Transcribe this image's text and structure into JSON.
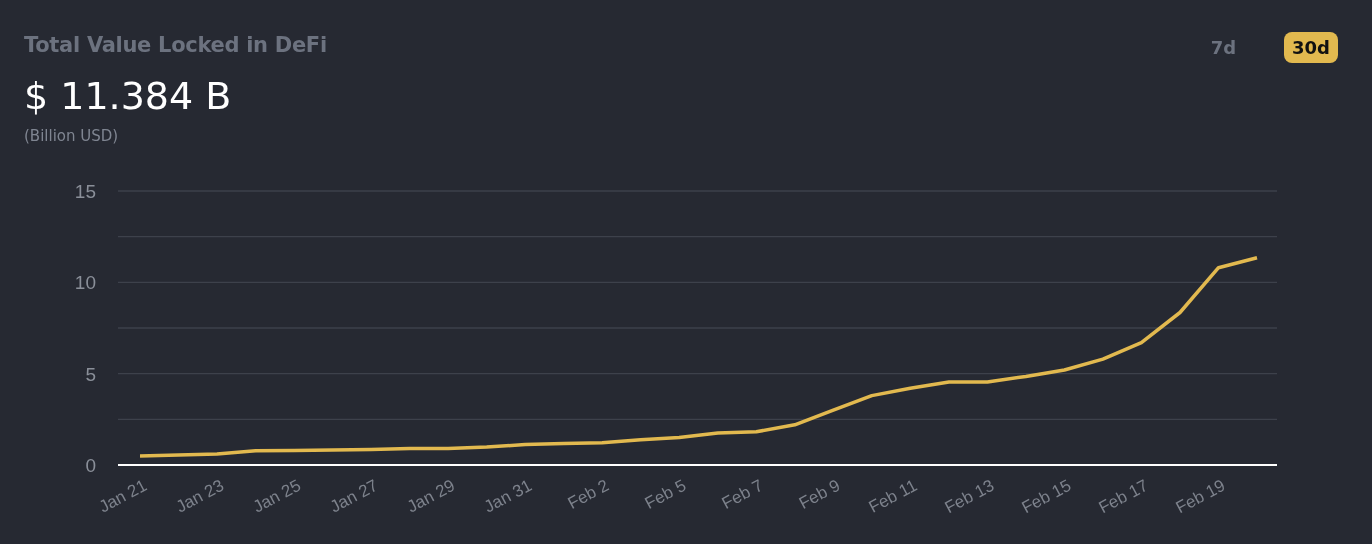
{
  "header": {
    "title": "Total Value Locked in DeFi",
    "value": "$ 11.384 B",
    "unit": "(Billion USD)"
  },
  "range_tabs": [
    {
      "label": "7d",
      "selected": false
    },
    {
      "label": "30d",
      "selected": true
    }
  ],
  "chart": {
    "chart_data": {
      "type": "line",
      "categories": [
        "Jan 21",
        null,
        "Jan 23",
        null,
        "Jan 25",
        null,
        "Jan 27",
        null,
        "Jan 29",
        null,
        "Jan 31",
        null,
        "Feb 2",
        null,
        "Feb 5",
        null,
        "Feb 7",
        null,
        "Feb 9",
        null,
        "Feb 11",
        null,
        "Feb 13",
        null,
        "Feb 15",
        null,
        "Feb 17",
        null,
        "Feb 19",
        null
      ],
      "series": [
        {
          "color": "#e2b94f",
          "values": [
            0.5,
            0.55,
            0.6,
            0.78,
            0.8,
            0.82,
            0.85,
            0.9,
            0.9,
            0.98,
            1.12,
            1.18,
            1.22,
            1.38,
            1.5,
            1.75,
            1.82,
            2.2,
            3.0,
            3.8,
            4.2,
            4.55,
            4.55,
            4.85,
            5.2,
            5.8,
            6.7,
            8.35,
            10.8,
            11.35
          ]
        }
      ],
      "ylim": [
        0,
        15
      ],
      "yticks": [
        0,
        5,
        10,
        15
      ]
    }
  }
}
